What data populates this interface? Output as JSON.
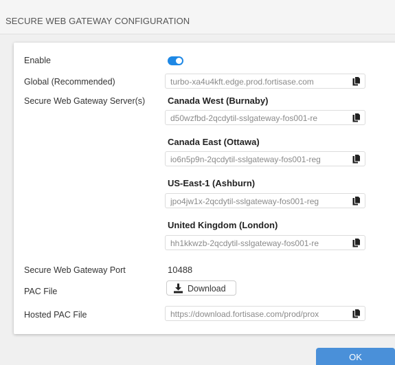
{
  "header": {
    "title": "SECURE WEB GATEWAY CONFIGURATION"
  },
  "form": {
    "enable_label": "Enable",
    "enable_state": "on",
    "global_label": "Global (Recommended)",
    "global_value": "turbo-xa4u4kft.edge.prod.fortisase.com",
    "servers_label": "Secure Web Gateway Server(s)",
    "servers": [
      {
        "region": "Canada West (Burnaby)",
        "host": "d50wzfbd-2qcdytil-sslgateway-fos001-re"
      },
      {
        "region": "Canada East (Ottawa)",
        "host": "io6n5p9n-2qcdytil-sslgateway-fos001-reg"
      },
      {
        "region": "US-East-1 (Ashburn)",
        "host": "jpo4jw1x-2qcdytil-sslgateway-fos001-reg"
      },
      {
        "region": "United Kingdom (London)",
        "host": "hh1kkwzb-2qcdytil-sslgateway-fos001-re"
      }
    ],
    "port_label": "Secure Web Gateway Port",
    "port_value": "10488",
    "pac_label": "PAC File",
    "download_label": "Download",
    "hosted_pac_label": "Hosted PAC File",
    "hosted_pac_value": "https://download.fortisase.com/prod/prox"
  },
  "footer": {
    "ok_label": "OK"
  },
  "icons": {
    "copy": "copy-icon",
    "download": "download-icon"
  },
  "colors": {
    "accent": "#1e88e5",
    "ok_button": "#4a90d9"
  }
}
